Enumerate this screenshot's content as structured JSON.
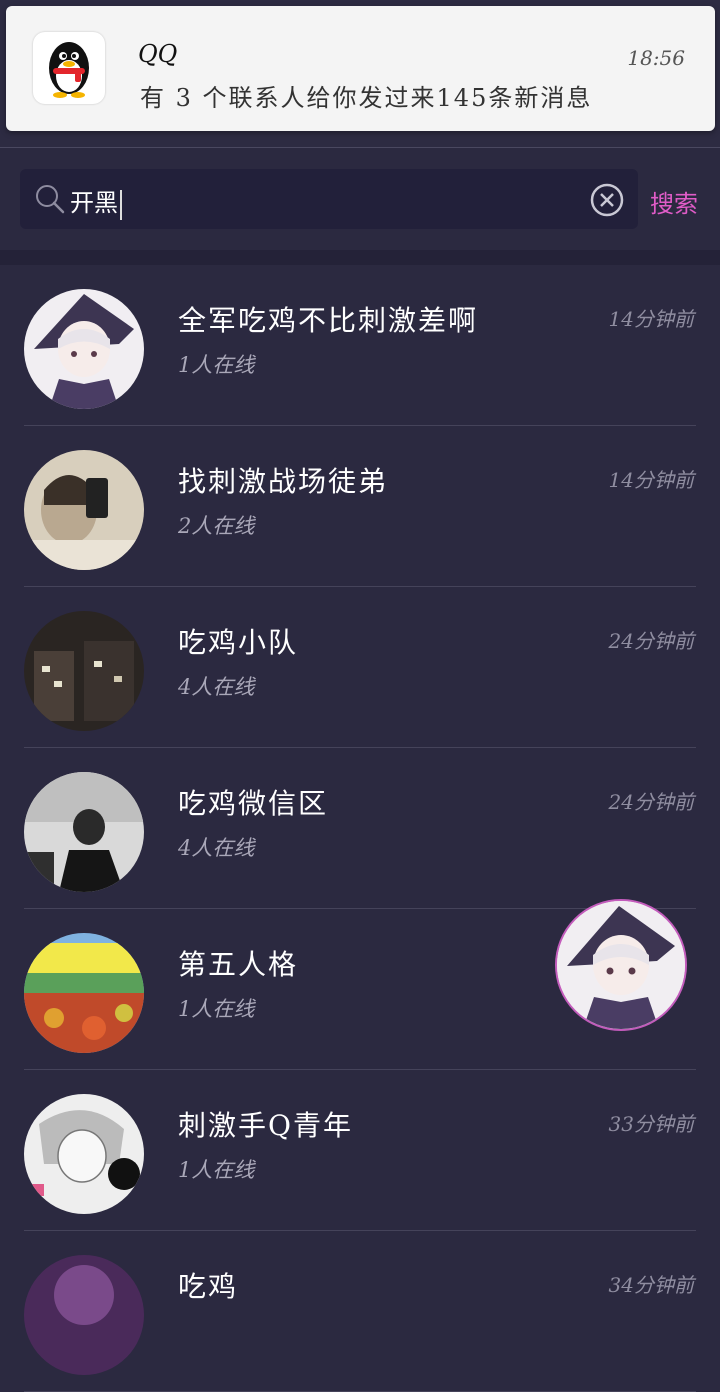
{
  "notification": {
    "app": "QQ",
    "time": "18:56",
    "message": "有 3 个联系人给你发过来145条新消息",
    "icon": "qq-penguin-icon"
  },
  "search": {
    "query": "开黑",
    "button_label": "搜索"
  },
  "colors": {
    "background": "#2b2940",
    "accent": "#e05cc8",
    "notification_bg": "#f4f4f4"
  },
  "results": [
    {
      "title": "全军吃鸡不比刺激差啊",
      "online": "1人在线",
      "time": "14分钟前"
    },
    {
      "title": "找刺激战场徒弟",
      "online": "2人在线",
      "time": "14分钟前"
    },
    {
      "title": "吃鸡小队",
      "online": "4人在线",
      "time": "24分钟前"
    },
    {
      "title": "吃鸡微信区",
      "online": "4人在线",
      "time": "24分钟前"
    },
    {
      "title": "第五人格",
      "online": "1人在线",
      "time": ""
    },
    {
      "title": "刺激手Q青年",
      "online": "1人在线",
      "time": "33分钟前"
    },
    {
      "title": "吃鸡",
      "online": "",
      "time": "34分钟前"
    }
  ]
}
